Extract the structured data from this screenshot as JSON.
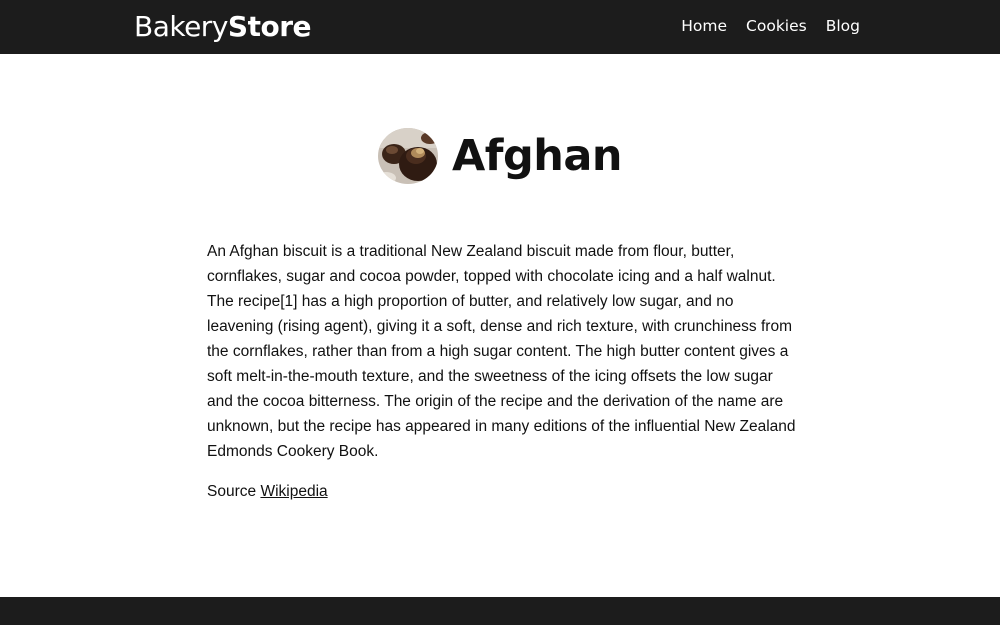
{
  "header": {
    "brand_light": "Bakery",
    "brand_bold": "Store",
    "nav": [
      {
        "label": "Home"
      },
      {
        "label": "Cookies"
      },
      {
        "label": "Blog"
      }
    ]
  },
  "main": {
    "title": "Afghan",
    "image_subject": "afghan-cookie-photo",
    "description": "An Afghan biscuit is a traditional New Zealand biscuit made from flour, butter, cornflakes, sugar and cocoa powder, topped with chocolate icing and a half walnut. The recipe[1] has a high proportion of butter, and relatively low sugar, and no leavening (rising agent), giving it a soft, dense and rich texture, with crunchiness from the cornflakes, rather than from a high sugar content. The high butter content gives a soft melt-in-the-mouth texture, and the sweetness of the icing offsets the low sugar and the cocoa bitterness. The origin of the recipe and the derivation of the name are unknown, but the recipe has appeared in many editions of the influential New Zealand Edmonds Cookery Book.",
    "source_prefix": "Source",
    "source_link": "Wikipedia"
  },
  "colors": {
    "navbar": "#1c1c1c",
    "footer": "#1c1c1c",
    "text": "#111111",
    "background": "#ffffff"
  }
}
